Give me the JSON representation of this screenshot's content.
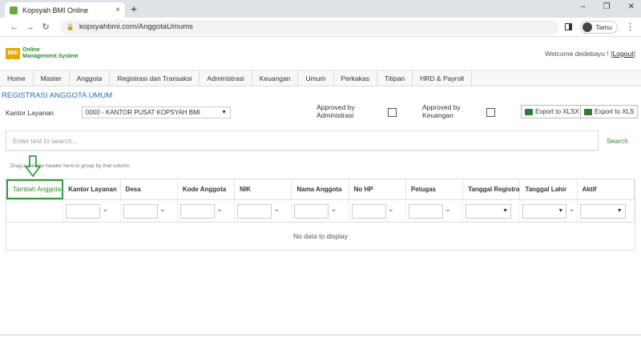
{
  "browser": {
    "tab_title": "Kopsyah BMI Online",
    "tab_close": "×",
    "new_tab": "+",
    "url": "kopsyahbmi.com/AnggotaUmums",
    "profile": "Tamu",
    "win_min": "–",
    "win_max": "❐",
    "win_close": "✕"
  },
  "header": {
    "logo_line1": "Online",
    "logo_line2": "Management System",
    "welcome": "Welcome dedebayu !",
    "logout": "Logout"
  },
  "menu": [
    "Home",
    "Master",
    "Anggota",
    "Registrasi dan Transaksi",
    "Administrasi",
    "Keuangan",
    "Umum",
    "Perkakas",
    "Titipan",
    "HRD & Payroll"
  ],
  "page": {
    "title": "REGISTRASI ANGGOTA UMUM",
    "kantor_label": "Kantor Layanan",
    "kantor_value": "0000 - KANTOR PUSAT KOPSYAH BMI",
    "approved_admin_1": "Approved by",
    "approved_admin_2": "Administrasi",
    "approved_keu_1": "Approved by",
    "approved_keu_2": "Keuangan",
    "export_xlsx": "Export to XLSX",
    "export_xls": "Export to XLS",
    "search_placeholder": "Enter text to search...",
    "search_button": "Search",
    "group_hint": "Drag a column header here to group by that column",
    "no_data": "No data to display"
  },
  "grid": {
    "columns": [
      "Tambah Anggota",
      "Kantor Layanan",
      "Desa",
      "Kode Anggota",
      "NIK",
      "Nama Anggota",
      "No HP",
      "Petugas",
      "Tanggal Registrasi",
      "Tanggal Lahir",
      "Aktif"
    ]
  },
  "colors": {
    "green": "#2e8b2e",
    "blue_title": "#2a6db0",
    "highlight": "#2e9e3a"
  }
}
